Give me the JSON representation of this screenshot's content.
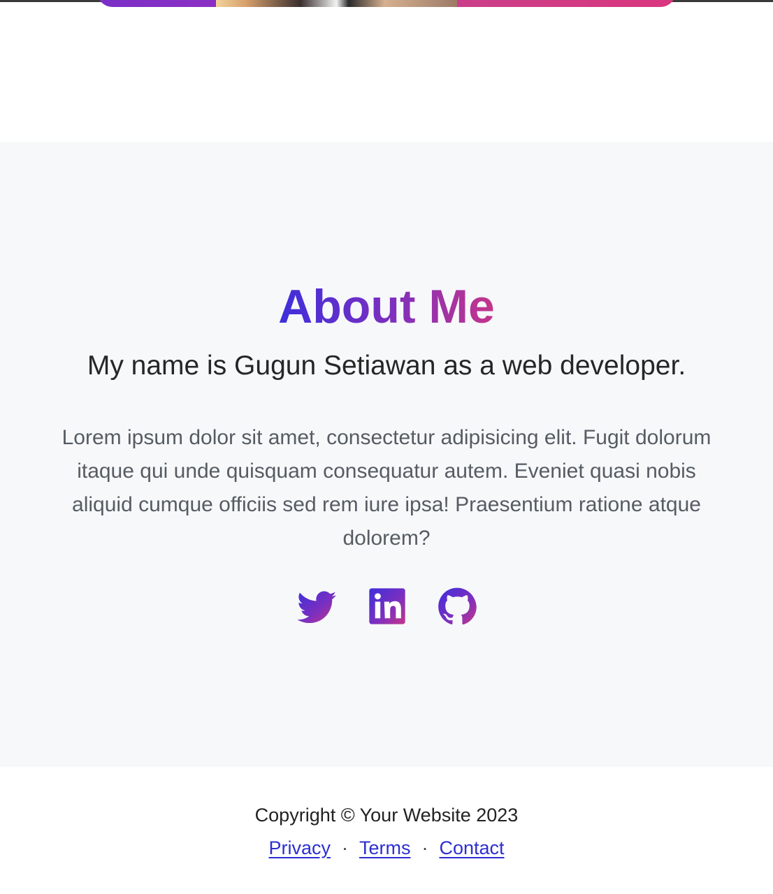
{
  "about": {
    "title": "About Me",
    "subtitle": "My name is Gugun Setiawan as a web developer.",
    "body": "Lorem ipsum dolor sit amet, consectetur adipisicing elit. Fugit dolorum itaque qui unde quisquam consequatur autem. Eveniet quasi nobis aliquid cumque officiis sed rem iure ipsa! Praesentium ratione atque dolorem?"
  },
  "social": [
    {
      "icon": "twitter-icon"
    },
    {
      "icon": "linkedin-icon"
    },
    {
      "icon": "github-icon"
    }
  ],
  "footer": {
    "copyright": "Copyright © Your Website 2023",
    "links": {
      "privacy": "Privacy",
      "terms": "Terms",
      "contact": "Contact"
    },
    "separator": "·"
  },
  "colors": {
    "gradient_start": "#3d2fdb",
    "gradient_mid": "#7a2fc0",
    "gradient_end": "#c4358b",
    "section_background": "#f7f8fa",
    "link": "#2d2fd0"
  }
}
